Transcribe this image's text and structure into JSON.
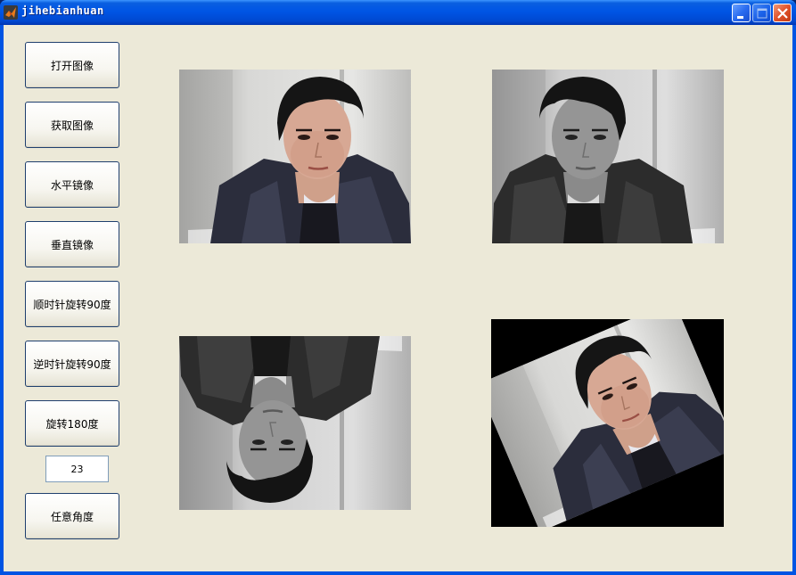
{
  "window": {
    "title": "jihebianhuan",
    "icon": "matlab-icon",
    "controls": [
      "minimize-icon",
      "maximize-icon",
      "close-icon"
    ]
  },
  "buttons": {
    "open_image": "打开图像",
    "get_image": "获取图像",
    "horizontal_mirror": "水平镜像",
    "vertical_mirror": "垂直镜像",
    "rotate_cw_90": "顺时针旋转90度",
    "rotate_ccw_90": "逆时针旋转90度",
    "rotate_180": "旋转180度",
    "arbitrary_angle": "任意角度"
  },
  "angle_input": {
    "value": "23"
  },
  "images": {
    "top_left": "original-color-photo",
    "top_right": "grayscale-photo",
    "bottom_left": "grayscale-flipped-photo",
    "bottom_right": "rotated-color-photo",
    "rotation_degrees": 23
  },
  "colors": {
    "titlebar": "#0055e5",
    "client_bg": "#ece9d8",
    "button_border": "#1f3f6e"
  }
}
